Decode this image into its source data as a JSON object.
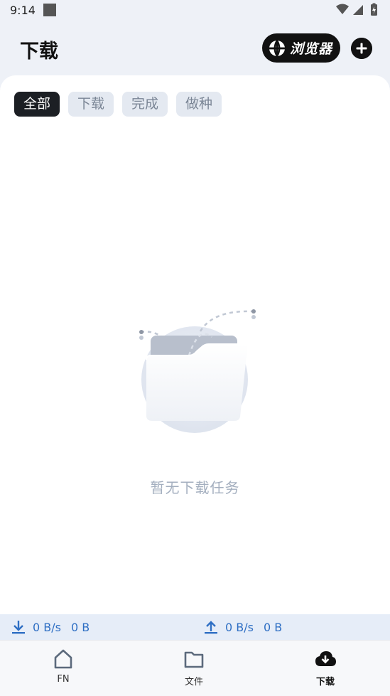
{
  "status_bar": {
    "time": "9:14",
    "icons": [
      "notification-square-icon",
      "wifi-icon",
      "signal-icon",
      "battery-icon"
    ]
  },
  "header": {
    "title": "下载",
    "browser_button_label": "浏览器",
    "add_button_icon": "plus-icon"
  },
  "tabs": [
    {
      "label": "全部",
      "active": true
    },
    {
      "label": "下载",
      "active": false
    },
    {
      "label": "完成",
      "active": false
    },
    {
      "label": "做种",
      "active": false
    }
  ],
  "empty_state": {
    "message": "暂无下载任务",
    "illustration": "empty-folder-illustration"
  },
  "transfer": {
    "download_speed": "0 B/s",
    "download_total": "0 B",
    "upload_speed": "0 B/s",
    "upload_total": "0 B"
  },
  "bottom_nav": [
    {
      "label": "FN",
      "icon": "home-icon",
      "active": false
    },
    {
      "label": "文件",
      "icon": "folder-icon",
      "active": false
    },
    {
      "label": "下载",
      "icon": "cloud-download-icon",
      "active": true
    }
  ],
  "colors": {
    "accent_blue": "#2f6fc4",
    "active_tab_bg": "#1c1f24",
    "inactive_tab_bg": "#e4e9f1",
    "page_bg": "#eef1f7"
  }
}
